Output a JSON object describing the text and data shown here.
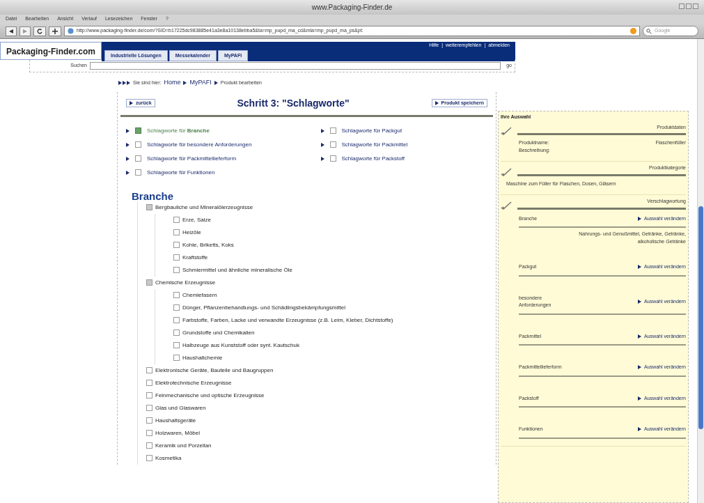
{
  "window": {
    "title": "www.Packaging-Finder.de"
  },
  "menu": [
    "Datei",
    "Bearbeiten",
    "Ansicht",
    "Verlauf",
    "Lesezeichen",
    "Fenster",
    "?"
  ],
  "address": {
    "url": "http://www.packaging-finder.de/com/?SID=b17225dc983885e41a3e8a10138ebba5&ta=mp_pupd_ma_cd&mla=mp_pupd_ma_ps&pt:",
    "search_placeholder": "Google"
  },
  "header": {
    "logo": "Packaging-Finder.com",
    "tabs": [
      "Industrielle Lösungen",
      "Messekalender",
      "MyPAFI"
    ],
    "links": [
      "Hilfe",
      "weiterempfehlen",
      "abmelden"
    ],
    "link_separator": "|"
  },
  "search": {
    "label": "Suchen",
    "button": "go"
  },
  "breadcrumb": {
    "prefix": "Sie sind hier:",
    "items": [
      "Home",
      "MyPAFI",
      "Produkt bearbeiten"
    ]
  },
  "step": {
    "back": "zurück",
    "title": "Schritt 3: \"Schlagworte\"",
    "save": "Produkt speichern"
  },
  "keyword_link_columns": [
    [
      {
        "label": "Schlagworte für **Branche**",
        "checked": true
      },
      {
        "label": "Schlagworte für besondere Anforderungen",
        "checked": false
      },
      {
        "label": "Schlagworte für Packmittellieferform",
        "checked": false
      },
      {
        "label": "Schlagworte für Funktionen",
        "checked": false
      }
    ],
    [
      {
        "label": "Schlagworte für Packgut",
        "checked": false
      },
      {
        "label": "Schlagworte für Packmittel",
        "checked": false
      },
      {
        "label": "Schlagworte für Packstoff",
        "checked": false
      }
    ]
  ],
  "tree": {
    "heading": "Branche",
    "nodes": [
      {
        "label": "Bergbauliche und Mineralölerzeugnisse",
        "checked": false,
        "children": [
          {
            "label": "Erze, Salze",
            "checked": false
          },
          {
            "label": "Heizöle",
            "checked": false
          },
          {
            "label": "Kohle, Briketts, Koks",
            "checked": false
          },
          {
            "label": "Kraftstoffe",
            "checked": false
          },
          {
            "label": "Schmiermittel und ähnliche mineralische Öle",
            "checked": false
          }
        ]
      },
      {
        "label": "Chemische Erzeugnisse",
        "checked": false,
        "children": [
          {
            "label": "Chemiefasern",
            "checked": false
          },
          {
            "label": "Dünger, Pflanzenbehandlungs- und Schädlingsbekämpfungsmittel",
            "checked": false
          },
          {
            "label": "Farbstoffe, Farben, Lacke und verwandte Erzeugnisse (z.B. Leim, Kleber, Dichtstoffe)",
            "checked": false
          },
          {
            "label": "Grundstoffe und Chemikalien",
            "checked": false
          },
          {
            "label": "Halbzeuge aus Kunststoff oder synt. Kautschuk",
            "checked": false
          },
          {
            "label": "Haushaltchemie",
            "checked": false
          }
        ]
      },
      {
        "label": "Elektronische Geräte, Bauteile und Baugruppen",
        "checked": false
      },
      {
        "label": "Elektrotechnische Erzeugnisse",
        "checked": false
      },
      {
        "label": "Feinmechanische und optische Erzeugnisse",
        "checked": false
      },
      {
        "label": "Glas und Glaswaren",
        "checked": false
      },
      {
        "label": "Haushaltsgeräte",
        "checked": false
      },
      {
        "label": "Holzwaren, Möbel",
        "checked": false
      },
      {
        "label": "Keramik und Porzellan",
        "checked": false
      },
      {
        "label": "Kosmetika",
        "checked": false
      }
    ]
  },
  "selection": {
    "title": "Ihre Auswahl",
    "sections": [
      {
        "kind": "fields",
        "title": "Produktdaten",
        "fields": [
          {
            "label": "Produktname:",
            "value": "Flaschenfüller"
          },
          {
            "label": "Beschreibung:"
          }
        ]
      },
      {
        "kind": "text",
        "title": "Produktkategorie",
        "text": "Maschine zum Füller für Flaschen, Dosen, Gläsern"
      },
      {
        "kind": "keywords",
        "title": "Verschlagwortung",
        "entries": [
          {
            "name": "Branche",
            "link": "Auswahl verändern",
            "value": "Nahrungs- und Genußmittel, Getränke, Getränke, alkoholische Getränke"
          },
          {
            "name": "Packgut",
            "link": "Auswahl verändern"
          },
          {
            "name": "besondere Anforderungen",
            "link": "Auswahl verändern"
          },
          {
            "name": "Packmittel",
            "link": "Auswahl verändern"
          },
          {
            "name": "Packmittellieferform",
            "link": "Auswahl verändern"
          },
          {
            "name": "Packstoff",
            "link": "Auswahl verändern"
          },
          {
            "name": "Funktionen",
            "link": "Auswahl verändern"
          }
        ]
      }
    ]
  }
}
